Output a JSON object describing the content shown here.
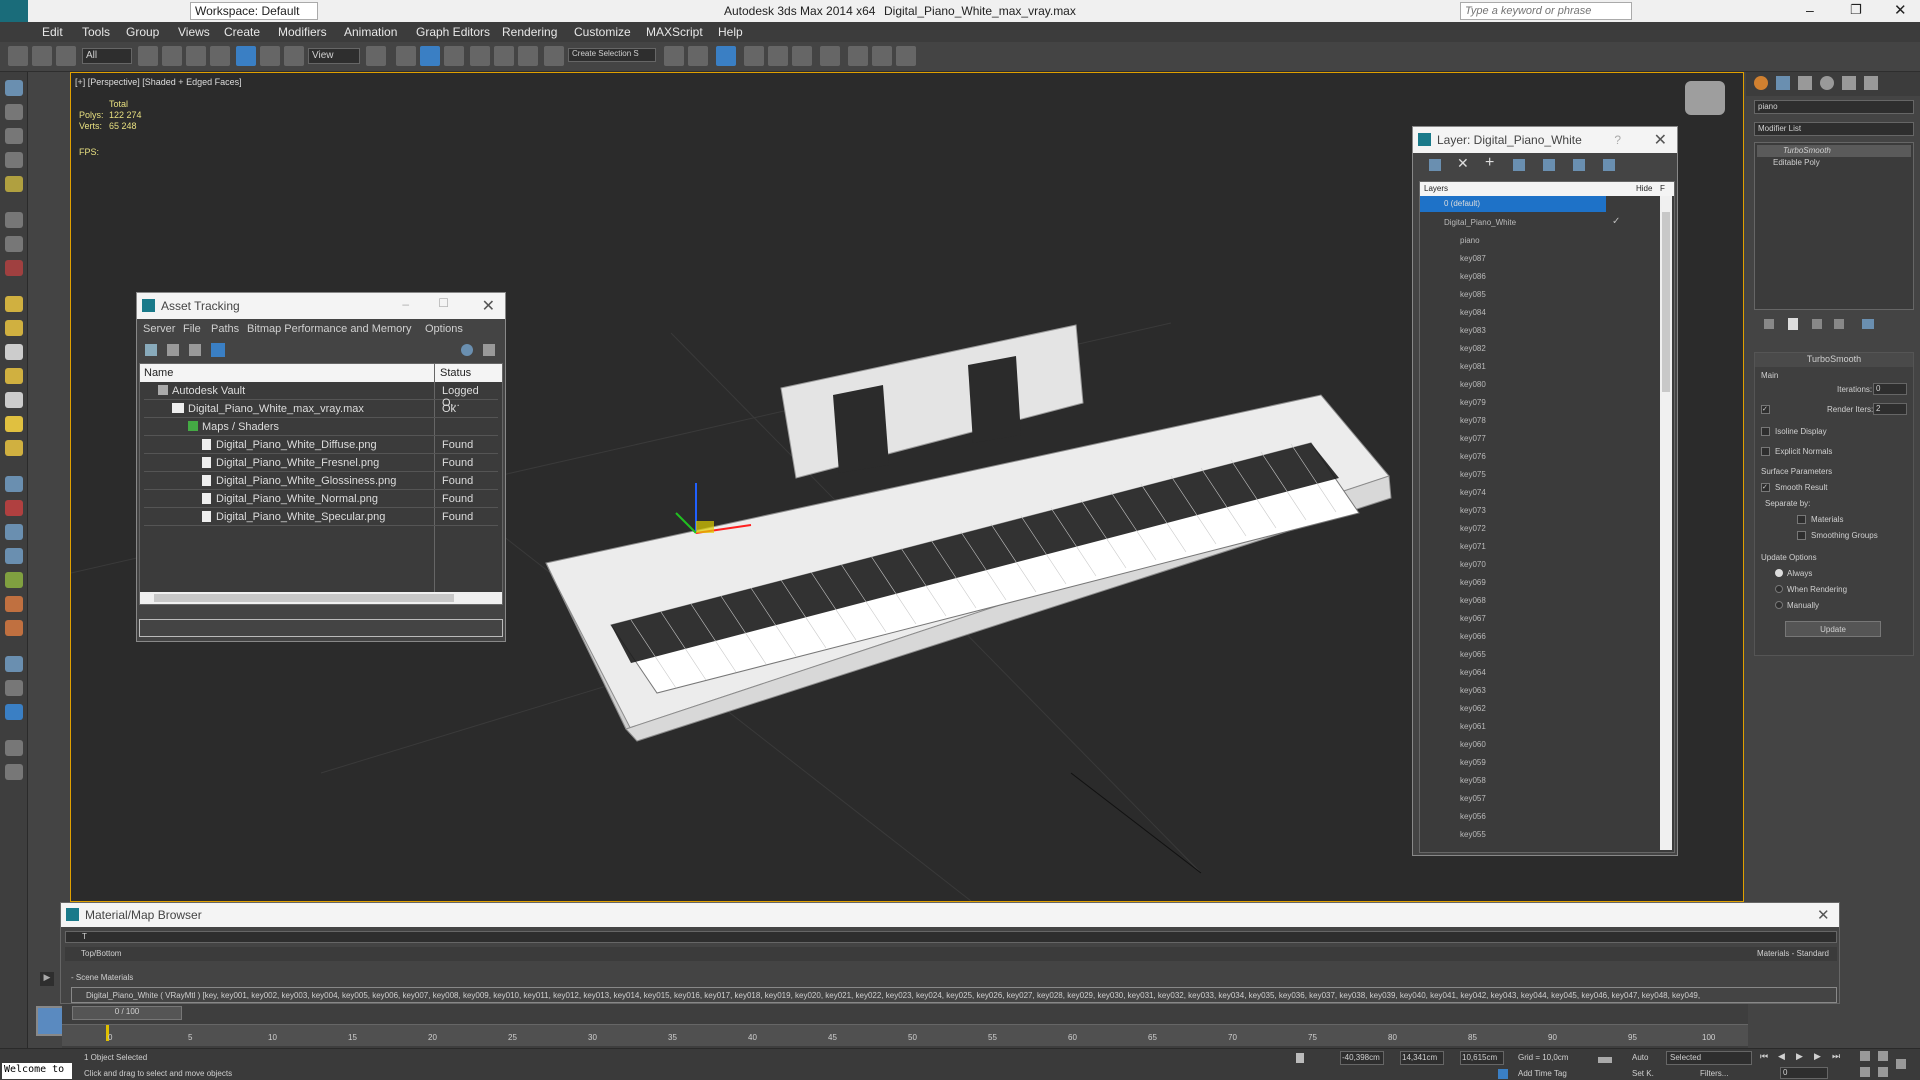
{
  "titlebar": {
    "workspace": "Workspace: Default",
    "app": "Autodesk 3ds Max  2014 x64",
    "file": "Digital_Piano_White_max_vray.max",
    "search_placeholder": "Type a keyword or phrase"
  },
  "menu": [
    "Edit",
    "Tools",
    "Group",
    "Views",
    "Create",
    "Modifiers",
    "Animation",
    "Graph Editors",
    "Rendering",
    "Customize",
    "MAXScript",
    "Help"
  ],
  "toolbar": {
    "filter": "All",
    "refcoord": "View",
    "selset": "Create Selection S"
  },
  "viewport": {
    "label": "[+] [Perspective] [Shaded + Edged Faces]",
    "total": "Total",
    "polys_label": "Polys:",
    "polys": "122 274",
    "verts_label": "Verts:",
    "verts": "65 248",
    "fps": "FPS:"
  },
  "asset": {
    "title": "Asset Tracking",
    "menu": [
      "Server",
      "File",
      "Paths",
      "Bitmap Performance and Memory",
      "Options"
    ],
    "col_name": "Name",
    "col_status": "Status",
    "rows": [
      {
        "name": "Autodesk Vault",
        "status": "Logged O...",
        "indent": 0
      },
      {
        "name": "Digital_Piano_White_max_vray.max",
        "status": "Ok",
        "indent": 1
      },
      {
        "name": "Maps / Shaders",
        "status": "",
        "indent": 2
      },
      {
        "name": "Digital_Piano_White_Diffuse.png",
        "status": "Found",
        "indent": 3
      },
      {
        "name": "Digital_Piano_White_Fresnel.png",
        "status": "Found",
        "indent": 3
      },
      {
        "name": "Digital_Piano_White_Glossiness.png",
        "status": "Found",
        "indent": 3
      },
      {
        "name": "Digital_Piano_White_Normal.png",
        "status": "Found",
        "indent": 3
      },
      {
        "name": "Digital_Piano_White_Specular.png",
        "status": "Found",
        "indent": 3
      }
    ]
  },
  "layer": {
    "title": "Layer: Digital_Piano_White",
    "help": "?",
    "col_layers": "Layers",
    "col_hide": "Hide",
    "col_f": "F",
    "rows": [
      "0 (default)",
      "Digital_Piano_White",
      "piano",
      "key087",
      "key086",
      "key085",
      "key084",
      "key083",
      "key082",
      "key081",
      "key080",
      "key079",
      "key078",
      "key077",
      "key076",
      "key075",
      "key074",
      "key073",
      "key072",
      "key071",
      "key070",
      "key069",
      "key068",
      "key067",
      "key066",
      "key065",
      "key064",
      "key063",
      "key062",
      "key061",
      "key060",
      "key059",
      "key058",
      "key057",
      "key056",
      "key055"
    ]
  },
  "cmd": {
    "name": "piano",
    "modlist": "Modifier List",
    "stack": [
      "TurboSmooth",
      "Editable Poly"
    ],
    "rollout": "TurboSmooth",
    "main": "Main",
    "iterations_label": "Iterations:",
    "iterations": "0",
    "render_label": "Render Iters:",
    "render": "2",
    "isoline": "Isoline Display",
    "explicit": "Explicit Normals",
    "surface": "Surface Parameters",
    "smooth": "Smooth Result",
    "separate": "Separate by:",
    "materials": "Materials",
    "smoothing": "Smoothing Groups",
    "update_opts": "Update Options",
    "always": "Always",
    "when_rendering": "When Rendering",
    "manually": "Manually",
    "update_btn": "Update"
  },
  "mtl": {
    "title": "Material/Map Browser",
    "filter": "T",
    "topbottom": "Top/Bottom",
    "std": "Materials - Standard",
    "scene": "- Scene Materials",
    "line": "Digital_Piano_White  ( VRayMtl )  [key, key001, key002, key003, key004, key005, key006, key007, key008, key009, key010, key011, key012, key013, key014, key015, key016, key017, key018, key019, key020, key021, key022, key023, key024, key025, key026, key027, key028, key029, key030, key031, key032, key033, key034, key035, key036, key037, key038, key039, key040, key041, key042, key043, key044, key045, key046, key047, key048, key049,"
  },
  "timeline": {
    "frame": "0 / 100",
    "ticks": [
      "0",
      "5",
      "10",
      "15",
      "20",
      "25",
      "30",
      "35",
      "40",
      "45",
      "50",
      "55",
      "60",
      "65",
      "70",
      "75",
      "80",
      "85",
      "90",
      "95",
      "100"
    ]
  },
  "status": {
    "welcome": "Welcome to",
    "selected": "1 Object Selected",
    "hint": "Click and drag to select and move objects",
    "x": "-40,398cm",
    "y": "14,341cm",
    "z": "10,615cm",
    "grid": "Grid = 10,0cm",
    "auto": "Auto",
    "selmode": "Selected",
    "setk": "Set K.",
    "filters": "Filters...",
    "addtag": "Add Time Tag",
    "frame": "0"
  }
}
